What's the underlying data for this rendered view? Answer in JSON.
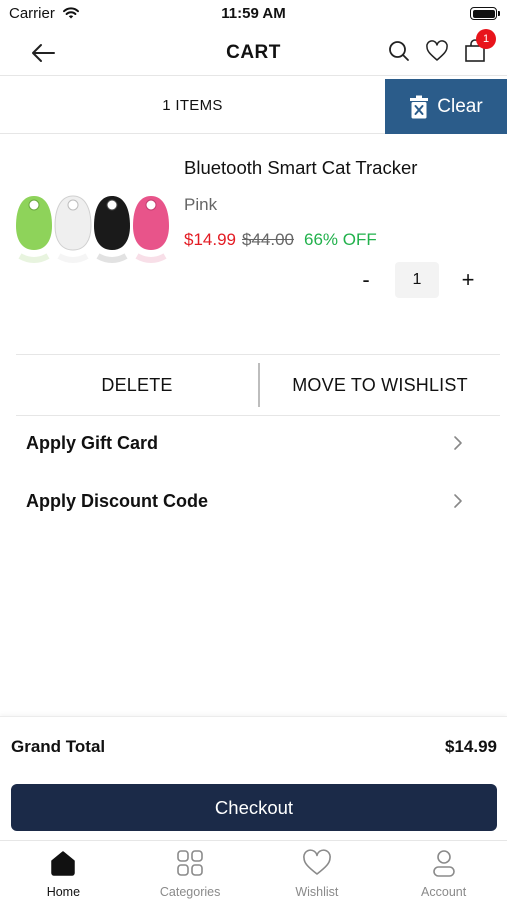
{
  "status_bar": {
    "carrier": "Carrier",
    "time": "11:59 AM"
  },
  "header": {
    "title": "CART",
    "cart_badge": "1"
  },
  "items_bar": {
    "count_label": "1 ITEMS",
    "clear_label": "Clear",
    "clear_color": "#2b5c8a"
  },
  "product": {
    "name": "Bluetooth Smart Cat Tracker",
    "variant": "Pink",
    "price": "$14.99",
    "original_price": "$44.00",
    "discount": "66% OFF",
    "quantity": "1",
    "minus_label": "-",
    "plus_label": "+",
    "image_colors": [
      "#8ed35a",
      "#ececec",
      "#1a1a1a",
      "#e8548a"
    ]
  },
  "actions": {
    "delete_label": "DELETE",
    "wishlist_label": "MOVE TO WISHLIST"
  },
  "options": {
    "gift_card_label": "Apply Gift Card",
    "discount_code_label": "Apply Discount Code"
  },
  "summary": {
    "grand_total_label": "Grand Total",
    "grand_total_value": "$14.99"
  },
  "checkout": {
    "label": "Checkout",
    "color": "#1b2a48"
  },
  "tabs": [
    {
      "label": "Home",
      "icon": "home-icon",
      "active": true
    },
    {
      "label": "Categories",
      "icon": "categories-icon",
      "active": false
    },
    {
      "label": "Wishlist",
      "icon": "heart-icon",
      "active": false
    },
    {
      "label": "Account",
      "icon": "account-icon",
      "active": false
    }
  ],
  "colors": {
    "price": "#e31b23",
    "discount": "#22b14c",
    "badge": "#e8141b"
  }
}
